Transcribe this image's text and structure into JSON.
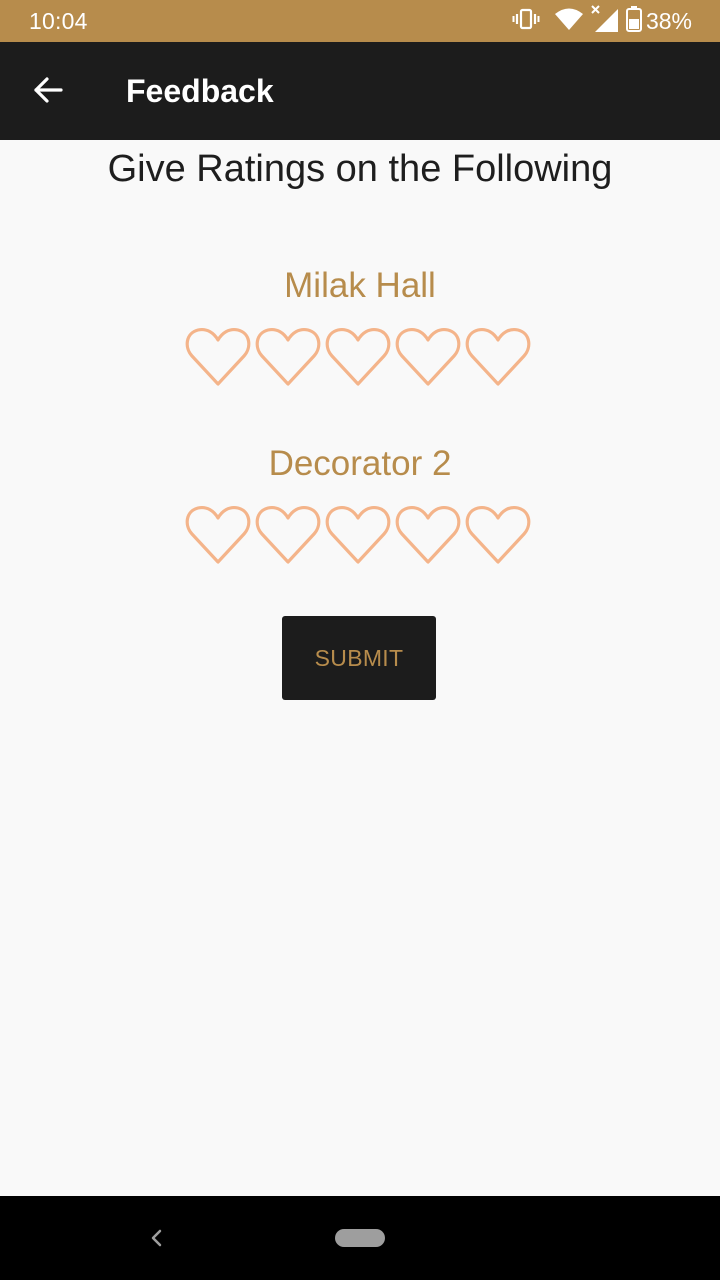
{
  "status_bar": {
    "time": "10:04",
    "battery": "38%",
    "icons": [
      "vibrate-icon",
      "wifi-icon",
      "signal-icon",
      "battery-icon"
    ]
  },
  "app_bar": {
    "title": "Feedback",
    "back_icon": "arrow-left-icon"
  },
  "heading": "Give Ratings on the Following",
  "ratings": [
    {
      "label": "Milak Hall",
      "max": 5,
      "value": 0
    },
    {
      "label": "Decorator 2",
      "max": 5,
      "value": 0
    }
  ],
  "submit_label": "SUBMIT",
  "colors": {
    "accent": "#b78c4c",
    "heart_outline": "#f4b48a",
    "app_bar": "#1c1c1c",
    "background": "#f9f9f9"
  },
  "nav_bar": {
    "back_icon": "nav-back-icon",
    "home_icon": "nav-home-pill"
  }
}
